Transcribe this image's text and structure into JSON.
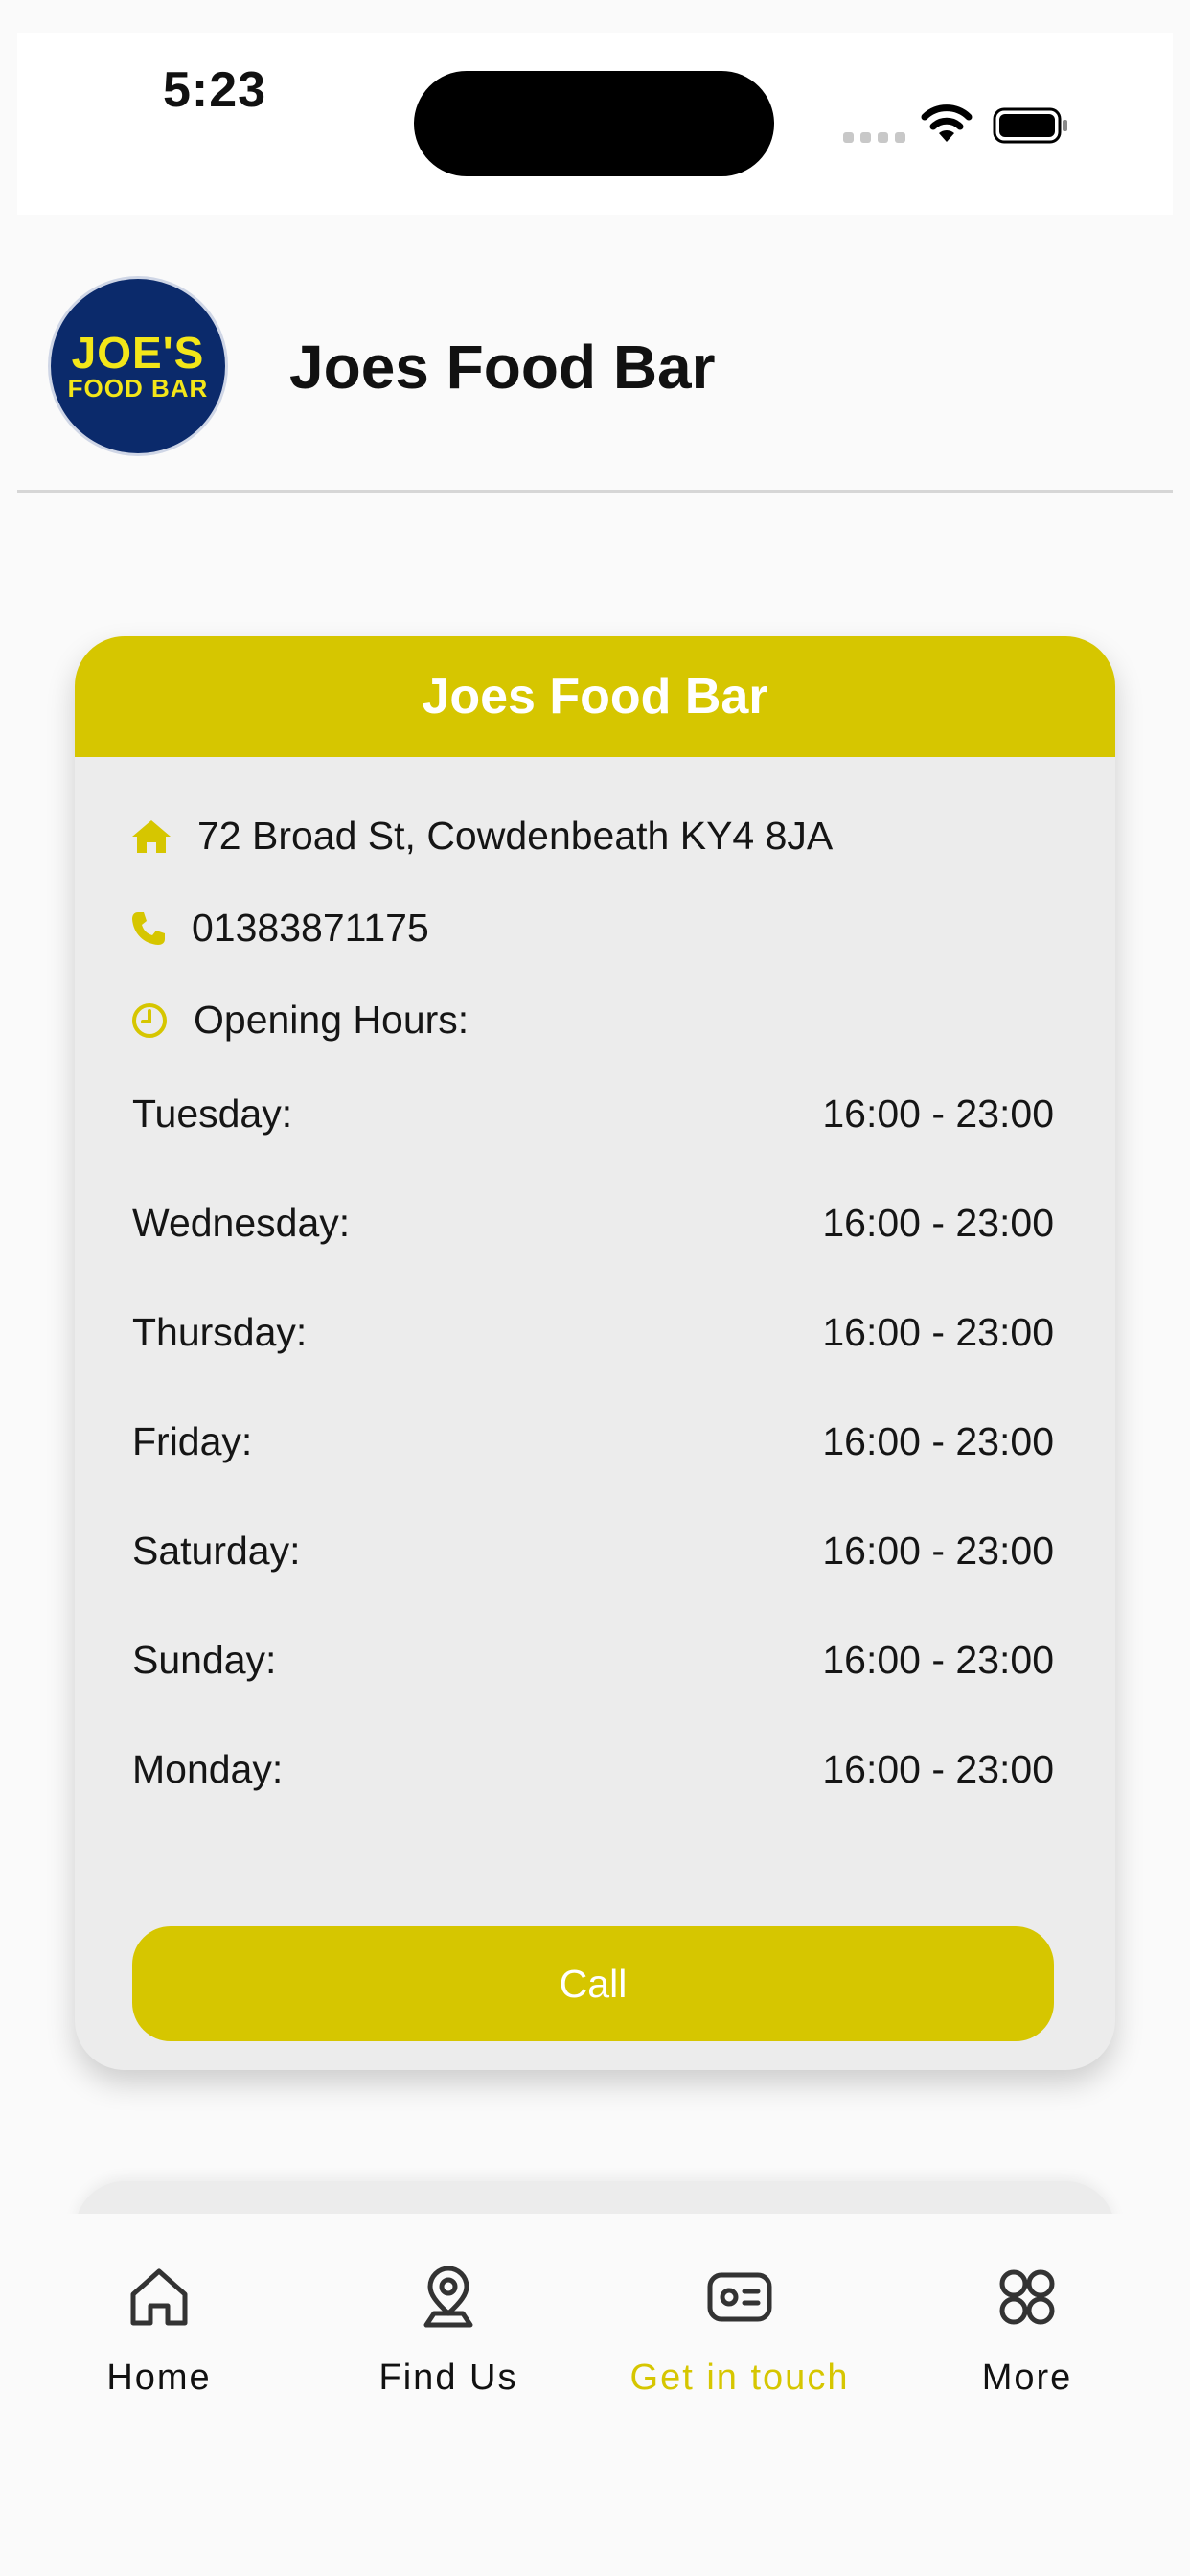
{
  "status_bar": {
    "time": "5:23"
  },
  "header": {
    "logo": {
      "line1": "JOE'S",
      "line2": "FOOD BAR"
    },
    "title": "Joes Food Bar"
  },
  "card": {
    "title": "Joes Food Bar",
    "address": "72 Broad St, Cowdenbeath KY4 8JA",
    "phone": "01383871175",
    "hours_label": "Opening Hours:",
    "hours": [
      {
        "day": "Tuesday:",
        "time": "16:00 - 23:00"
      },
      {
        "day": "Wednesday:",
        "time": "16:00 - 23:00"
      },
      {
        "day": "Thursday:",
        "time": "16:00 - 23:00"
      },
      {
        "day": "Friday:",
        "time": "16:00 - 23:00"
      },
      {
        "day": "Saturday:",
        "time": "16:00 - 23:00"
      },
      {
        "day": "Sunday:",
        "time": "16:00 - 23:00"
      },
      {
        "day": "Monday:",
        "time": "16:00 - 23:00"
      }
    ],
    "call_label": "Call"
  },
  "nav": {
    "items": [
      {
        "label": "Home",
        "icon": "home-icon"
      },
      {
        "label": "Find Us",
        "icon": "location-pin-icon"
      },
      {
        "label": "Get in touch",
        "icon": "contact-card-icon",
        "active": true
      },
      {
        "label": "More",
        "icon": "grid-icon"
      }
    ]
  },
  "colors": {
    "accent": "#d6c600",
    "card_bg": "#ececec",
    "page_bg": "#fafafa",
    "logo_bg": "#0b2a6b",
    "logo_text": "#f3e619"
  }
}
